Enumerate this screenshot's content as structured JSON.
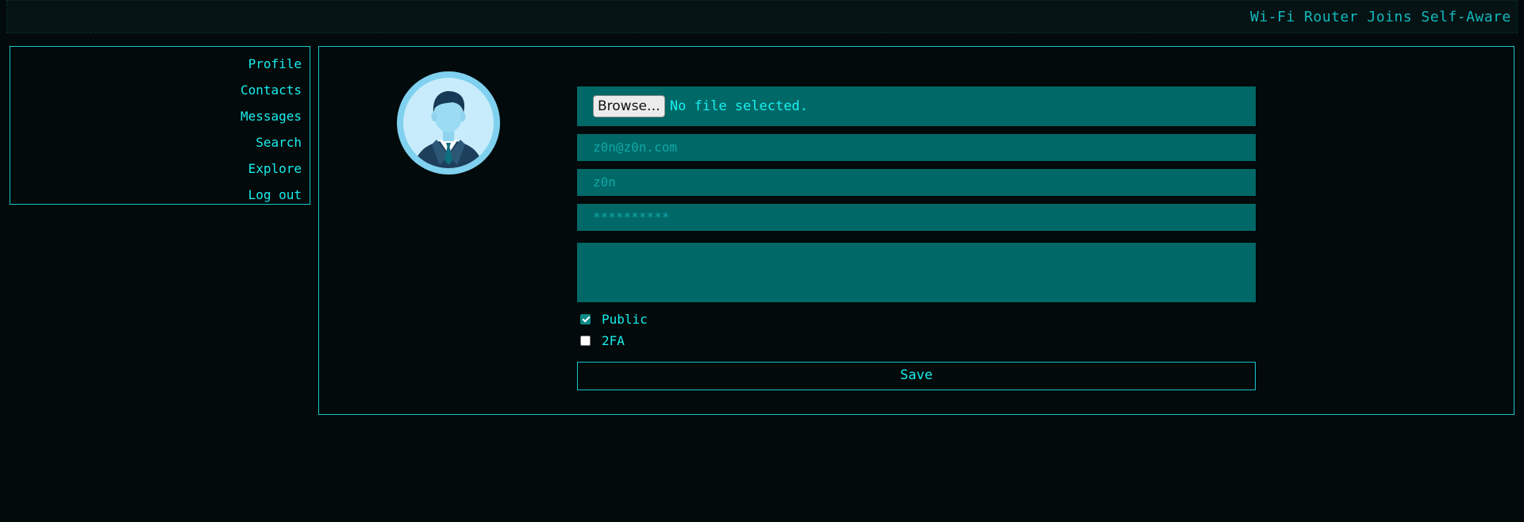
{
  "ticker": {
    "text": "Wi-Fi Router Joins Self-Aware Ne"
  },
  "sidebar": {
    "items": [
      {
        "label": "Profile",
        "icon": ""
      },
      {
        "label": "Contacts"
      },
      {
        "label": "Messages"
      },
      {
        "label": "Search"
      },
      {
        "label": "Explore"
      },
      {
        "label": "Log out"
      }
    ]
  },
  "profile": {
    "avatar_icon": "user-avatar-icon",
    "file": {
      "button_label": "Browse…",
      "status": "No file selected."
    },
    "email": {
      "placeholder": "z0n@z0n.com",
      "value": ""
    },
    "username": {
      "placeholder": "z0n",
      "value": ""
    },
    "password": {
      "placeholder": "**********",
      "value": ""
    },
    "bio": {
      "value": ""
    },
    "public": {
      "label": "Public",
      "checked": true
    },
    "twofa": {
      "label": "2FA",
      "checked": false
    },
    "save_label": "Save"
  },
  "colors": {
    "background": "#020a0b",
    "accent": "#14e8e8",
    "field_bg": "#006866",
    "border": "#13c7ce"
  }
}
